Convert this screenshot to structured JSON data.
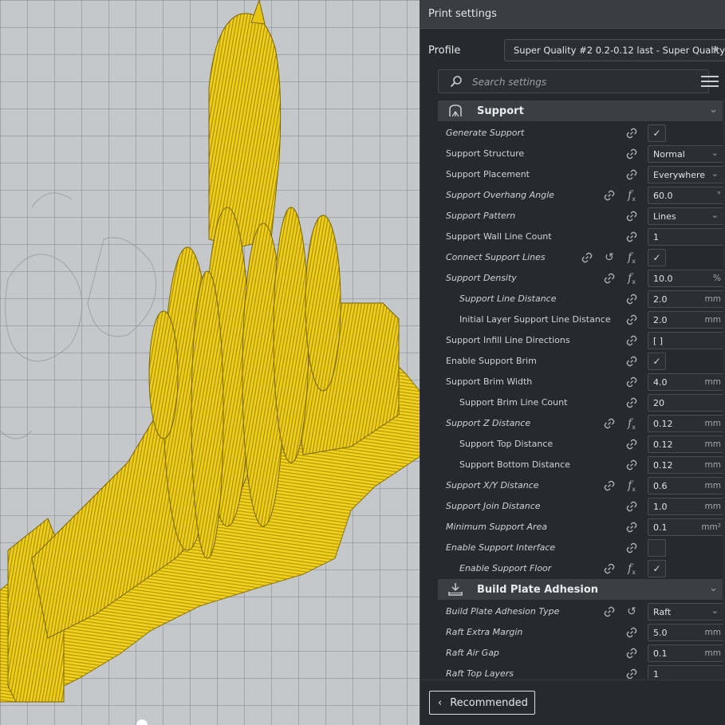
{
  "panel": {
    "title": "Print settings",
    "profile_label": "Profile",
    "profile_value": "Super Quality #2 0.2-0.12 last - Super Quality -",
    "search_placeholder": "Search settings",
    "footer_button": "Recommended"
  },
  "categories": {
    "support": "Support",
    "adhesion": "Build Plate Adhesion"
  },
  "rows": [
    {
      "label": "Generate Support",
      "type": "check",
      "checked": "✓"
    },
    {
      "label": "Support Structure",
      "type": "select",
      "value": "Normal"
    },
    {
      "label": "Support Placement",
      "type": "select",
      "value": "Everywhere"
    },
    {
      "label": "Support Overhang Angle",
      "type": "number",
      "value": "60.0",
      "unit": "°"
    },
    {
      "label": "Support Pattern",
      "type": "select",
      "value": "Lines"
    },
    {
      "label": "Support Wall Line Count",
      "type": "number",
      "value": "1",
      "unit": ""
    },
    {
      "label": "Connect Support Lines",
      "type": "check",
      "checked": "✓"
    },
    {
      "label": "Support Density",
      "type": "number",
      "value": "10.0",
      "unit": "%"
    },
    {
      "label": "Support Line Distance",
      "type": "number",
      "value": "2.0",
      "unit": "mm"
    },
    {
      "label": "Initial Layer Support Line Distance",
      "type": "number",
      "value": "2.0",
      "unit": "mm"
    },
    {
      "label": "Support Infill Line Directions",
      "type": "text",
      "value": "[ ]",
      "unit": ""
    },
    {
      "label": "Enable Support Brim",
      "type": "check",
      "checked": "✓"
    },
    {
      "label": "Support Brim Width",
      "type": "number",
      "value": "4.0",
      "unit": "mm"
    },
    {
      "label": "Support Brim Line Count",
      "type": "number",
      "value": "20",
      "unit": ""
    },
    {
      "label": "Support Z Distance",
      "type": "number",
      "value": "0.12",
      "unit": "mm"
    },
    {
      "label": "Support Top Distance",
      "type": "number",
      "value": "0.12",
      "unit": "mm"
    },
    {
      "label": "Support Bottom Distance",
      "type": "number",
      "value": "0.12",
      "unit": "mm"
    },
    {
      "label": "Support X/Y Distance",
      "type": "number",
      "value": "0.6",
      "unit": "mm"
    },
    {
      "label": "Support Join Distance",
      "type": "number",
      "value": "1.0",
      "unit": "mm"
    },
    {
      "label": "Minimum Support Area",
      "type": "number",
      "value": "0.1",
      "unit": "mm²"
    },
    {
      "label": "Enable Support Interface",
      "type": "check",
      "checked": ""
    },
    {
      "label": "Enable Support Floor",
      "type": "check",
      "checked": "✓"
    },
    {
      "label": "Build Plate Adhesion Type",
      "type": "select",
      "value": "Raft"
    },
    {
      "label": "Raft Extra Margin",
      "type": "number",
      "value": "5.0",
      "unit": "mm"
    },
    {
      "label": "Raft Air Gap",
      "type": "number",
      "value": "0.1",
      "unit": "mm"
    },
    {
      "label": "Raft Top Layers",
      "type": "number",
      "value": "1",
      "unit": ""
    }
  ],
  "colors": {
    "model": "#f2d21b",
    "panel_bg": "#26292d",
    "buildplate": "#c5c8ca"
  },
  "icons": [
    "search-icon",
    "menu-icon",
    "support-category-icon",
    "adhesion-category-icon",
    "link-icon",
    "reset-icon",
    "function-icon",
    "star-icon",
    "chevron-down-icon"
  ]
}
